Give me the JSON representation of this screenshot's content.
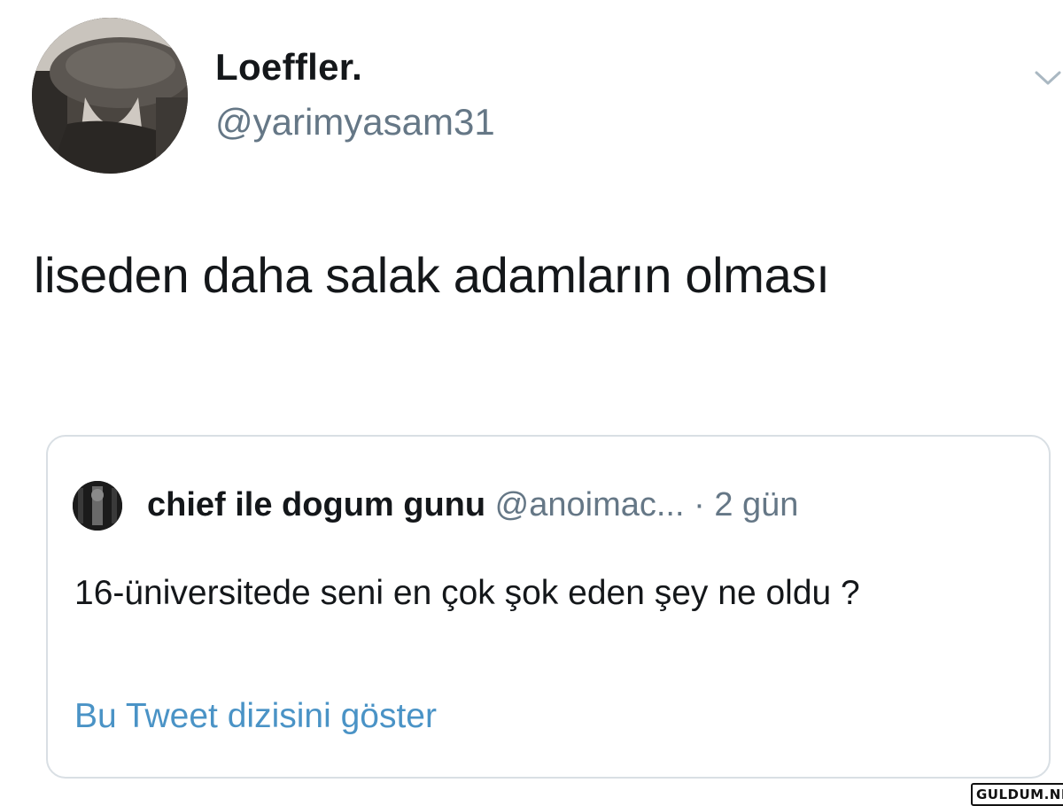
{
  "tweet": {
    "author_name": "Loeffler.",
    "author_handle": "@yarimyasam31",
    "text": "liseden daha salak adamların olması",
    "menu_icon": "chevron-down-icon"
  },
  "quoted_tweet": {
    "author_name": "chief ile dogum gunu",
    "author_handle": "@anoimac...",
    "separator": "·",
    "time": "2 gün",
    "text": "16-üniversitede seni en çok şok eden şey ne oldu ?",
    "show_thread_label": "Bu Tweet dizisini göster"
  },
  "watermark": "GULDUM.NET",
  "colors": {
    "text": "#14171a",
    "secondary": "#657786",
    "link": "#4a93c6",
    "border": "#d9dfe4"
  }
}
